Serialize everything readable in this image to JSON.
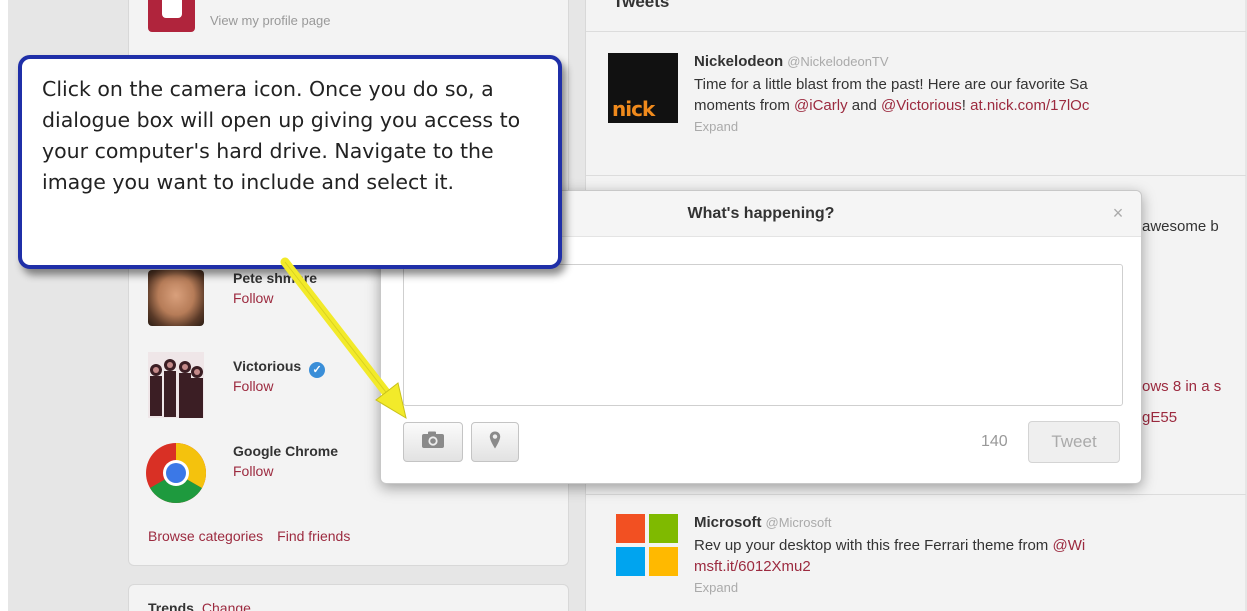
{
  "profile": {
    "link_text": "View my profile page"
  },
  "tweets_header": "Tweets",
  "suggestions": [
    {
      "name": "Pete Cashmore",
      "name_visible": "Pete ",
      "name_tail": "shmore",
      "follow": "Follow"
    },
    {
      "name": "Victorious",
      "follow": "Follow",
      "verified": true
    },
    {
      "name": "Google Chrome",
      "follow": "Follow"
    }
  ],
  "sidebar_links": {
    "browse": "Browse categories",
    "find": "Find friends"
  },
  "trends": {
    "label": "Trends",
    "change": "Change"
  },
  "tweets": [
    {
      "name": "Nickelodeon",
      "handle": "@NickelodeonTV",
      "line1": "Time for a little blast from the past! Here are our favorite Sa",
      "line2_pre": "moments from ",
      "mention1": "@iCarly",
      "line2_mid": " and ",
      "mention2": "@Victorious",
      "line2_post": "! ",
      "link": "at.nick.com/17lOc",
      "expand": "Expand",
      "avatar_text": "nick"
    },
    {
      "name": "Microsoft",
      "handle": "@Microsoft",
      "line1": "Rev up your desktop with this free Ferrari theme from ",
      "mention": "@Wi",
      "link": "msft.it/6012Xmu2",
      "expand": "Expand"
    }
  ],
  "peeks": {
    "awesome": "awesome b",
    "ows": "ows 8 in a s",
    "ge55": "gE55"
  },
  "modal": {
    "title": "What's happening?",
    "close": "×",
    "textarea_value": "",
    "char_count": "140",
    "tweet_button": "Tweet"
  },
  "callout": {
    "text": "Click on the camera icon. Once you do so, a dialogue box will open up giving you access to your computer's hard drive. Navigate to the image you want to include and select it."
  },
  "colors": {
    "callout_border": "#1f2fa8",
    "arrow": "#f2ea2a",
    "link": "#9c2a3f"
  },
  "icons": [
    "camera-icon",
    "location-pin-icon",
    "verified-badge-icon",
    "close-icon"
  ]
}
